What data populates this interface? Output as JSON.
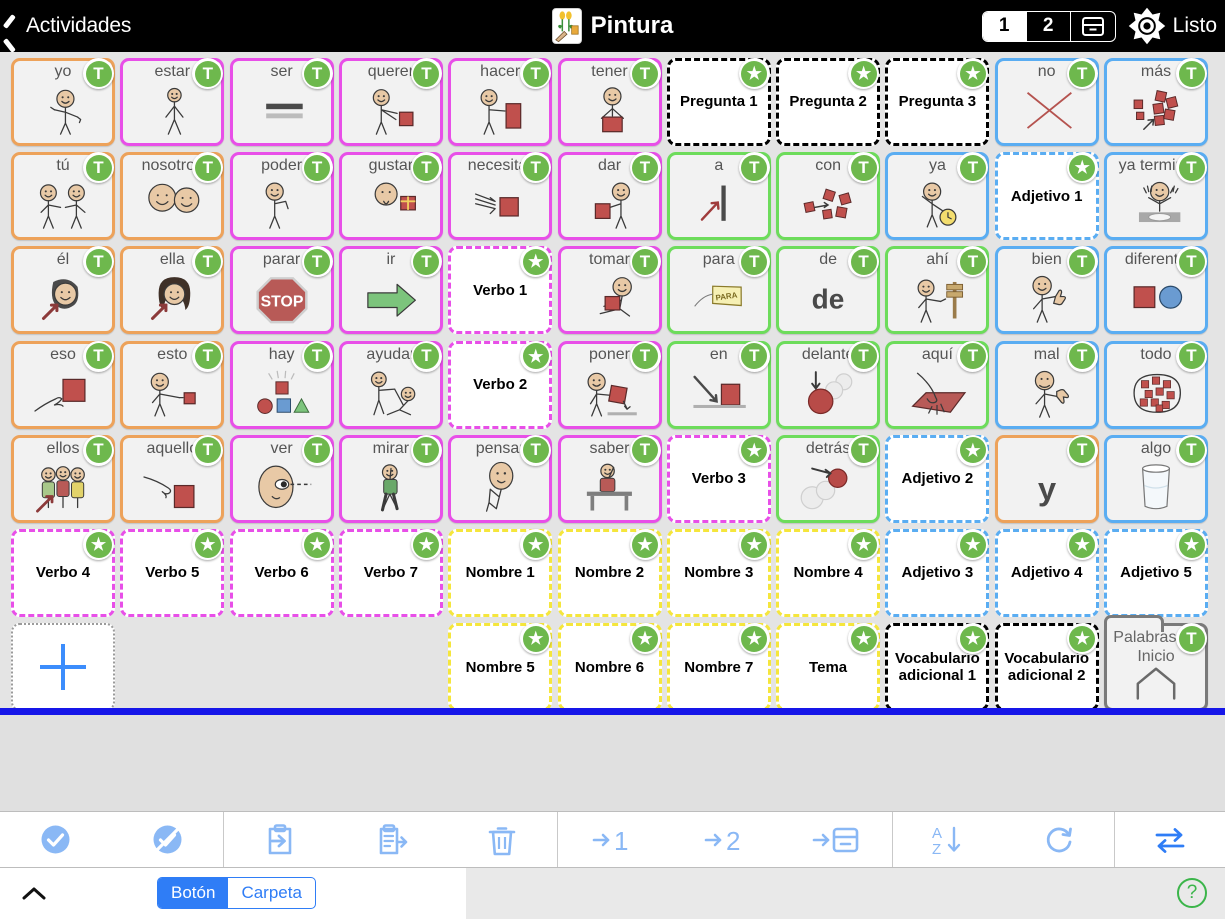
{
  "header": {
    "back_label": "Actividades",
    "title": "Pintura",
    "title_icon": "flower-picture-icon",
    "segments": [
      {
        "label": "1",
        "selected": true
      },
      {
        "label": "2",
        "selected": false
      },
      {
        "label": "box-icon",
        "selected": false
      }
    ],
    "gear_icon": "gear-icon",
    "ready_label": "Listo"
  },
  "colors": {
    "orange": "#eda25a",
    "magenta": "#e84fe8",
    "green": "#6ddc5b",
    "blue": "#5aadf2",
    "yellow": "#f5e63c",
    "black": "#000000",
    "gray": "#9b9b9b",
    "badge_green": "#6eb84d",
    "accent_blue": "#2f7df6",
    "divider_blue": "#1616e8"
  },
  "grid": {
    "columns": 11,
    "rows": 7,
    "cells": [
      {
        "r": 0,
        "c": 0,
        "label": "yo",
        "badge": "T",
        "border": "orange",
        "art": "person-pointing-self"
      },
      {
        "r": 0,
        "c": 1,
        "label": "estar",
        "badge": "T",
        "border": "magenta",
        "art": "person-standing"
      },
      {
        "r": 0,
        "c": 2,
        "label": "ser",
        "badge": "T",
        "border": "magenta",
        "art": "equals-bars"
      },
      {
        "r": 0,
        "c": 3,
        "label": "querer",
        "badge": "T",
        "border": "magenta",
        "art": "person-reaching-square"
      },
      {
        "r": 0,
        "c": 4,
        "label": "hacer",
        "badge": "T",
        "border": "magenta",
        "art": "person-making-square"
      },
      {
        "r": 0,
        "c": 5,
        "label": "tener",
        "badge": "T",
        "border": "magenta",
        "art": "person-holding-square"
      },
      {
        "r": 0,
        "c": 6,
        "center": "Pregunta 1",
        "badge": "star",
        "border": "black",
        "dashed": true,
        "empty": true
      },
      {
        "r": 0,
        "c": 7,
        "center": "Pregunta 2",
        "badge": "star",
        "border": "black",
        "dashed": true,
        "empty": true
      },
      {
        "r": 0,
        "c": 8,
        "center": "Pregunta 3",
        "badge": "star",
        "border": "black",
        "dashed": true,
        "empty": true
      },
      {
        "r": 0,
        "c": 9,
        "label": "no",
        "badge": "T",
        "border": "blue",
        "art": "red-x"
      },
      {
        "r": 0,
        "c": 10,
        "label": "más",
        "badge": "T",
        "border": "blue",
        "art": "many-squares"
      },
      {
        "r": 1,
        "c": 0,
        "label": "tú",
        "badge": "T",
        "border": "orange",
        "art": "two-people-pointing"
      },
      {
        "r": 1,
        "c": 1,
        "label": "nosotros",
        "badge": "T",
        "border": "orange",
        "art": "two-heads"
      },
      {
        "r": 1,
        "c": 2,
        "label": "poder",
        "badge": "T",
        "border": "magenta",
        "art": "person-flexing"
      },
      {
        "r": 1,
        "c": 3,
        "label": "gustar",
        "badge": "T",
        "border": "magenta",
        "art": "face-licking-gift"
      },
      {
        "r": 1,
        "c": 4,
        "label": "necesitar",
        "badge": "T",
        "border": "magenta",
        "art": "hands-square"
      },
      {
        "r": 1,
        "c": 5,
        "label": "dar",
        "badge": "T",
        "border": "magenta",
        "art": "person-giving-square"
      },
      {
        "r": 1,
        "c": 6,
        "label": "a",
        "badge": "T",
        "border": "green",
        "art": "arrow-to-post"
      },
      {
        "r": 1,
        "c": 7,
        "label": "con",
        "badge": "T",
        "border": "green",
        "art": "squares-joining"
      },
      {
        "r": 1,
        "c": 8,
        "label": "ya",
        "badge": "T",
        "border": "blue",
        "art": "person-with-clock"
      },
      {
        "r": 1,
        "c": 9,
        "center": "Adjetivo 1",
        "badge": "star",
        "border": "blue",
        "dashed": true,
        "empty": true
      },
      {
        "r": 1,
        "c": 10,
        "label": "ya terminé",
        "badge": "T",
        "border": "blue",
        "art": "person-hands-up-plate"
      },
      {
        "r": 2,
        "c": 0,
        "label": "él",
        "badge": "T",
        "border": "orange",
        "art": "boy-head-arrow"
      },
      {
        "r": 2,
        "c": 1,
        "label": "ella",
        "badge": "T",
        "border": "orange",
        "art": "girl-head-arrow"
      },
      {
        "r": 2,
        "c": 2,
        "label": "parar",
        "badge": "T",
        "border": "magenta",
        "art": "stop-sign"
      },
      {
        "r": 2,
        "c": 3,
        "label": "ir",
        "badge": "T",
        "border": "magenta",
        "art": "green-arrow"
      },
      {
        "r": 2,
        "c": 4,
        "center": "Verbo 1",
        "badge": "star",
        "border": "magenta",
        "dashed": true,
        "empty": true
      },
      {
        "r": 2,
        "c": 5,
        "label": "tomar",
        "badge": "T",
        "border": "magenta",
        "art": "person-taking-square"
      },
      {
        "r": 2,
        "c": 6,
        "label": "para",
        "badge": "T",
        "border": "green",
        "art": "para-tag"
      },
      {
        "r": 2,
        "c": 7,
        "label": "de",
        "badge": "T",
        "border": "green",
        "art": "word-de"
      },
      {
        "r": 2,
        "c": 8,
        "label": "ahí",
        "badge": "T",
        "border": "green",
        "art": "person-pointing-signpost"
      },
      {
        "r": 2,
        "c": 9,
        "label": "bien",
        "badge": "T",
        "border": "blue",
        "art": "thumbs-up-person"
      },
      {
        "r": 2,
        "c": 10,
        "label": "diferente",
        "badge": "T",
        "border": "blue",
        "art": "square-and-circle"
      },
      {
        "r": 3,
        "c": 0,
        "label": "eso",
        "badge": "T",
        "border": "orange",
        "art": "hand-pointing-square"
      },
      {
        "r": 3,
        "c": 1,
        "label": "esto",
        "badge": "T",
        "border": "orange",
        "art": "person-pointing-small-square"
      },
      {
        "r": 3,
        "c": 2,
        "label": "hay",
        "badge": "T",
        "border": "magenta",
        "art": "shapes-shining"
      },
      {
        "r": 3,
        "c": 3,
        "label": "ayudar",
        "badge": "T",
        "border": "magenta",
        "art": "person-helping"
      },
      {
        "r": 3,
        "c": 4,
        "center": "Verbo 2",
        "badge": "star",
        "border": "magenta",
        "dashed": true,
        "empty": true
      },
      {
        "r": 3,
        "c": 5,
        "label": "poner",
        "badge": "T",
        "border": "magenta",
        "art": "person-putting-square"
      },
      {
        "r": 3,
        "c": 6,
        "label": "en",
        "badge": "T",
        "border": "green",
        "art": "arrow-into-square"
      },
      {
        "r": 3,
        "c": 7,
        "label": "delante",
        "badge": "T",
        "border": "green",
        "art": "circles-front"
      },
      {
        "r": 3,
        "c": 8,
        "label": "aquí",
        "badge": "T",
        "border": "green",
        "art": "hand-tapping-surface"
      },
      {
        "r": 3,
        "c": 9,
        "label": "mal",
        "badge": "T",
        "border": "blue",
        "art": "thumbs-down-person"
      },
      {
        "r": 3,
        "c": 10,
        "label": "todo",
        "badge": "T",
        "border": "blue",
        "art": "all-squares-circled"
      },
      {
        "r": 4,
        "c": 0,
        "label": "ellos",
        "badge": "T",
        "border": "orange",
        "art": "three-people-arrow"
      },
      {
        "r": 4,
        "c": 1,
        "label": "aquello",
        "badge": "T",
        "border": "orange",
        "art": "hand-pointing-far-square"
      },
      {
        "r": 4,
        "c": 2,
        "label": "ver",
        "badge": "T",
        "border": "magenta",
        "art": "eye-looking"
      },
      {
        "r": 4,
        "c": 3,
        "label": "mirar",
        "badge": "T",
        "border": "magenta",
        "art": "person-walking-looking"
      },
      {
        "r": 4,
        "c": 4,
        "label": "pensar",
        "badge": "T",
        "border": "magenta",
        "art": "person-thinking"
      },
      {
        "r": 4,
        "c": 5,
        "label": "saber",
        "badge": "T",
        "border": "magenta",
        "art": "person-raising-hand-desk"
      },
      {
        "r": 4,
        "c": 6,
        "center": "Verbo 3",
        "badge": "star",
        "border": "magenta",
        "dashed": true,
        "empty": true
      },
      {
        "r": 4,
        "c": 7,
        "label": "detrás",
        "badge": "T",
        "border": "green",
        "art": "circles-behind"
      },
      {
        "r": 4,
        "c": 8,
        "center": "Adjetivo 2",
        "badge": "star",
        "border": "blue",
        "dashed": true,
        "empty": true
      },
      {
        "r": 4,
        "c": 9,
        "label": "",
        "badge": "T",
        "border": "orange",
        "art": "word-y"
      },
      {
        "r": 4,
        "c": 10,
        "label": "algo",
        "badge": "T",
        "border": "blue",
        "art": "glass-of-water"
      },
      {
        "r": 5,
        "c": 0,
        "center": "Verbo 4",
        "badge": "star",
        "border": "magenta",
        "dashed": true,
        "empty": true
      },
      {
        "r": 5,
        "c": 1,
        "center": "Verbo 5",
        "badge": "star",
        "border": "magenta",
        "dashed": true,
        "empty": true
      },
      {
        "r": 5,
        "c": 2,
        "center": "Verbo 6",
        "badge": "star",
        "border": "magenta",
        "dashed": true,
        "empty": true
      },
      {
        "r": 5,
        "c": 3,
        "center": "Verbo 7",
        "badge": "star",
        "border": "magenta",
        "dashed": true,
        "empty": true
      },
      {
        "r": 5,
        "c": 4,
        "center": "Nombre 1",
        "badge": "star",
        "border": "yellow",
        "dashed": true,
        "empty": true
      },
      {
        "r": 5,
        "c": 5,
        "center": "Nombre 2",
        "badge": "star",
        "border": "yellow",
        "dashed": true,
        "empty": true
      },
      {
        "r": 5,
        "c": 6,
        "center": "Nombre 3",
        "badge": "star",
        "border": "yellow",
        "dashed": true,
        "empty": true
      },
      {
        "r": 5,
        "c": 7,
        "center": "Nombre 4",
        "badge": "star",
        "border": "yellow",
        "dashed": true,
        "empty": true
      },
      {
        "r": 5,
        "c": 8,
        "center": "Adjetivo 3",
        "badge": "star",
        "border": "blue",
        "dashed": true,
        "empty": true
      },
      {
        "r": 5,
        "c": 9,
        "center": "Adjetivo 4",
        "badge": "star",
        "border": "blue",
        "dashed": true,
        "empty": true
      },
      {
        "r": 5,
        "c": 10,
        "center": "Adjetivo 5",
        "badge": "star",
        "border": "blue",
        "dashed": true,
        "empty": true
      },
      {
        "r": 6,
        "c": 0,
        "kind": "add",
        "icon": "plus-icon"
      },
      {
        "r": 6,
        "c": 4,
        "center": "Nombre 5",
        "badge": "star",
        "border": "yellow",
        "dashed": true,
        "empty": true
      },
      {
        "r": 6,
        "c": 5,
        "center": "Nombre 6",
        "badge": "star",
        "border": "yellow",
        "dashed": true,
        "empty": true
      },
      {
        "r": 6,
        "c": 6,
        "center": "Nombre 7",
        "badge": "star",
        "border": "yellow",
        "dashed": true,
        "empty": true
      },
      {
        "r": 6,
        "c": 7,
        "center": "Tema",
        "badge": "star",
        "border": "yellow",
        "dashed": true,
        "empty": true
      },
      {
        "r": 6,
        "c": 8,
        "center": "Vocabulario adicional 1",
        "badge": "star",
        "border": "black",
        "dashed": true,
        "empty": true
      },
      {
        "r": 6,
        "c": 9,
        "center": "Vocabulario adicional 2",
        "badge": "star",
        "border": "black",
        "dashed": true,
        "empty": true
      },
      {
        "r": 6,
        "c": 10,
        "kind": "folder",
        "label": "Palabras de Inicio",
        "badge": "T",
        "art": "home-icon"
      }
    ]
  },
  "toolbar": {
    "groups": [
      {
        "items": [
          {
            "name": "select-all-button",
            "icon": "check-circle-icon"
          },
          {
            "name": "deselect-all-button",
            "icon": "check-circle-slash-icon"
          }
        ]
      },
      {
        "items": [
          {
            "name": "import-button",
            "icon": "clipboard-in-icon"
          },
          {
            "name": "export-button",
            "icon": "clipboard-out-icon"
          },
          {
            "name": "delete-button",
            "icon": "trash-icon"
          }
        ]
      },
      {
        "items": [
          {
            "name": "move-to-page-1-button",
            "icon": "arrow-1-icon",
            "label": "1"
          },
          {
            "name": "move-to-page-2-button",
            "icon": "arrow-2-icon",
            "label": "2"
          },
          {
            "name": "move-to-box-button",
            "icon": "arrow-box-icon"
          }
        ]
      },
      {
        "items": [
          {
            "name": "sort-az-button",
            "icon": "sort-az-icon"
          },
          {
            "name": "refresh-button",
            "icon": "refresh-icon"
          }
        ]
      },
      {
        "items": [
          {
            "name": "swap-button",
            "icon": "swap-arrows-icon"
          }
        ]
      }
    ]
  },
  "bottom": {
    "collapse_icon": "chevron-up-icon",
    "mode_options": [
      {
        "label": "Botón",
        "selected": true
      },
      {
        "label": "Carpeta",
        "selected": false
      }
    ],
    "help_icon": "question-mark-icon",
    "help_label": "?"
  }
}
